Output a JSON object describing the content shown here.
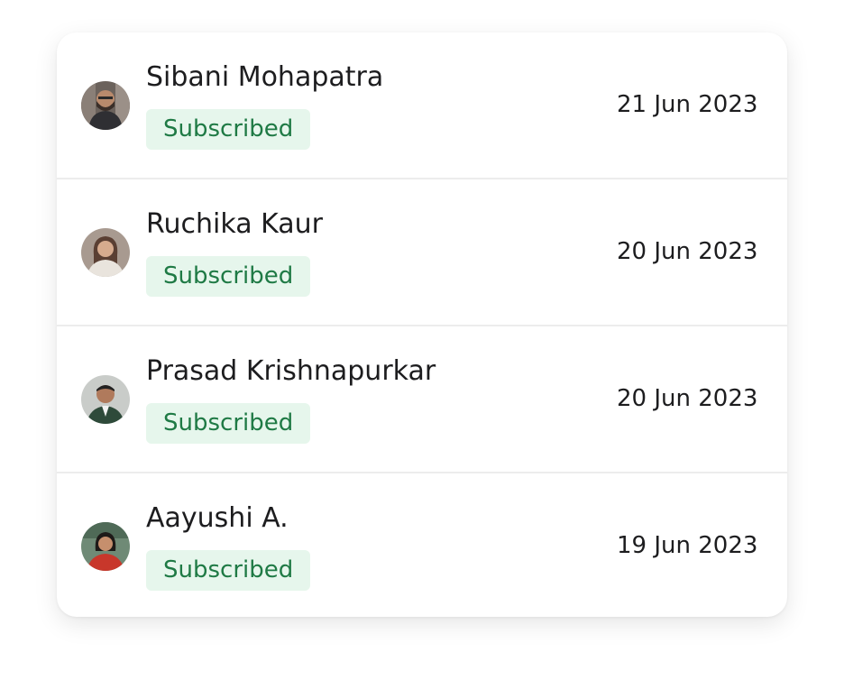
{
  "badge_colors": {
    "background": "#e6f6ec",
    "text": "#1f7a45"
  },
  "subscribers": [
    {
      "name": "Sibani Mohapatra",
      "status": "Subscribed",
      "date": "21 Jun 2023",
      "avatar_icon": "user-photo-avatar"
    },
    {
      "name": "Ruchika Kaur",
      "status": "Subscribed",
      "date": "20 Jun 2023",
      "avatar_icon": "user-photo-avatar"
    },
    {
      "name": "Prasad Krishnapurkar",
      "status": "Subscribed",
      "date": "20 Jun 2023",
      "avatar_icon": "user-photo-avatar"
    },
    {
      "name": "Aayushi A.",
      "status": "Subscribed",
      "date": "19 Jun 2023",
      "avatar_icon": "user-photo-avatar"
    }
  ]
}
